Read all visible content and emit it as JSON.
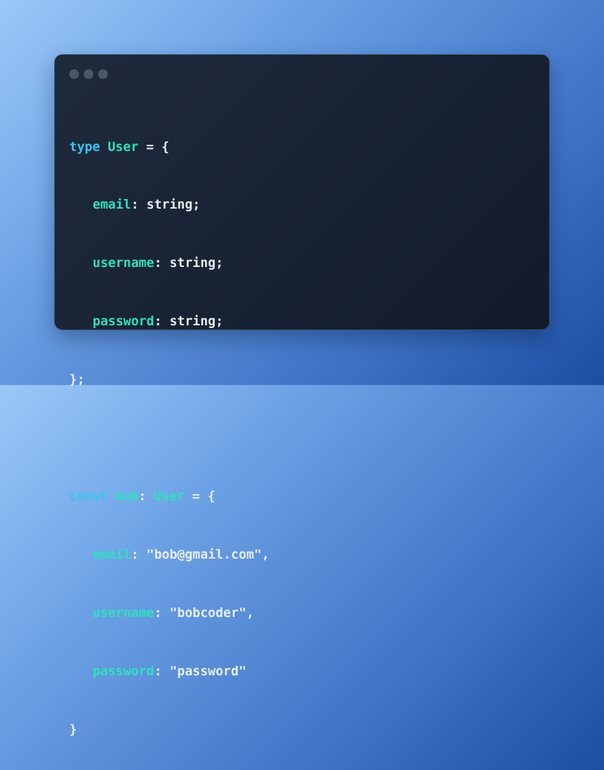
{
  "window": {
    "controls": [
      "close",
      "minimize",
      "maximize"
    ]
  },
  "colors": {
    "keyword": "#38c6f0",
    "type_name": "#2ee0c0",
    "property": "#2ee0c0",
    "plain": "#e6edf5",
    "dot": "#4b5668"
  },
  "code": {
    "type_block": {
      "keyword": "type",
      "name": "User",
      "open": " = {",
      "fields": [
        {
          "prop": "email",
          "rest": ": string;"
        },
        {
          "prop": "username",
          "rest": ": string;"
        },
        {
          "prop": "password",
          "rest": ": string;"
        }
      ],
      "close": "};"
    },
    "const_block": {
      "keyword": "const",
      "name": "bob",
      "colon": ": ",
      "type_ref": "User",
      "open": " = {",
      "fields": [
        {
          "prop": "email",
          "rest": ": \"bob@gmail.com\","
        },
        {
          "prop": "username",
          "rest": ": \"bobcoder\","
        },
        {
          "prop": "password",
          "rest": ": \"password\""
        }
      ],
      "close": "}"
    }
  }
}
